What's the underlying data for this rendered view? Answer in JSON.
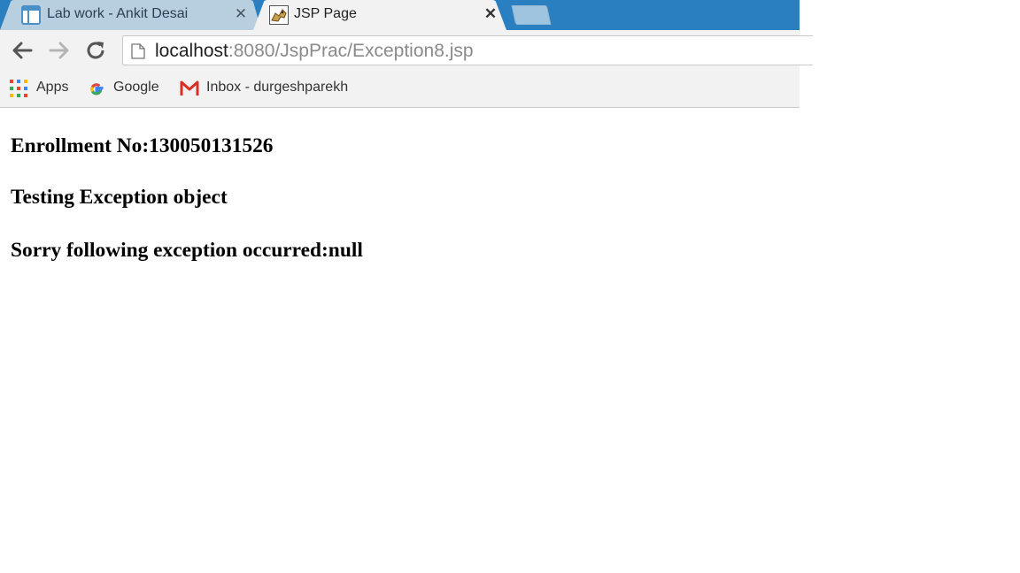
{
  "tabs": [
    {
      "title": "Lab work - Ankit Desai",
      "icon": "document-icon",
      "active": false
    },
    {
      "title": "JSP Page",
      "icon": "tomcat-icon",
      "active": true
    }
  ],
  "toolbar": {
    "url_host": "localhost",
    "url_rest": ":8080/JspPrac/Exception8.jsp"
  },
  "bookmarks": [
    {
      "label": "Apps",
      "icon": "apps-grid-icon"
    },
    {
      "label": "Google",
      "icon": "google-icon"
    },
    {
      "label": "Inbox - durgeshparekh",
      "icon": "gmail-icon"
    }
  ],
  "page": {
    "headings": [
      "Enrollment No:130050131526",
      "Testing Exception object",
      "Sorry following exception occurred:null"
    ]
  },
  "colors": {
    "tabstrip": "#2a7fc0",
    "inactive_tab": "#b8cfe0",
    "active_tab": "#f2f2f2",
    "toolbar": "#f2f2f2"
  }
}
